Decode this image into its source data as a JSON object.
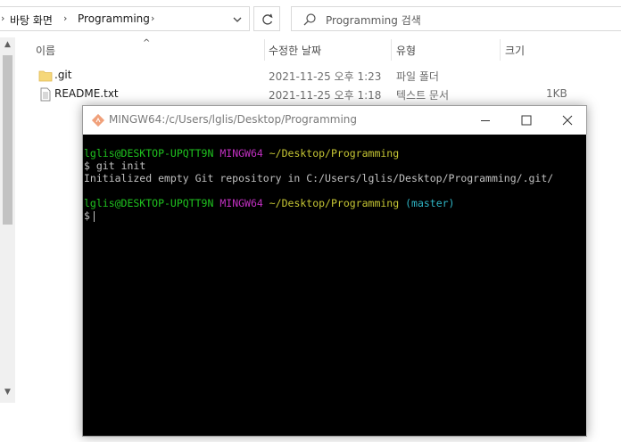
{
  "explorer": {
    "address": {
      "crumbs": [
        "바탕 화면",
        "Programming"
      ]
    },
    "search": {
      "placeholder": "Programming 검색"
    },
    "columns": {
      "name": "이름",
      "modified": "수정한 날짜",
      "type": "유형",
      "size": "크기"
    },
    "files": [
      {
        "name": ".git",
        "modified": "2021-11-25 오후 1:23",
        "type": "파일 폴더",
        "size": "",
        "icon": "folder-icon"
      },
      {
        "name": "README.txt",
        "modified": "2021-11-25 오후 1:18",
        "type": "텍스트 문서",
        "size": "1KB",
        "icon": "text-file-icon"
      }
    ]
  },
  "terminal": {
    "title": "MINGW64:/c/Users/lglis/Desktop/Programming",
    "user_host": "lglis@DESKTOP-UPQTT9N",
    "shell": "MINGW64",
    "cwd": "~/Desktop/Programming",
    "branch": "(master)",
    "prompt": "$",
    "command": "git init",
    "output": "Initialized empty Git repository in C:/Users/lglis/Desktop/Programming/.git/",
    "colors": {
      "user_host": "#1fc41f",
      "shell": "#c030c0",
      "cwd": "#c6c634",
      "branch": "#2fb5c5",
      "background": "#000000"
    }
  }
}
